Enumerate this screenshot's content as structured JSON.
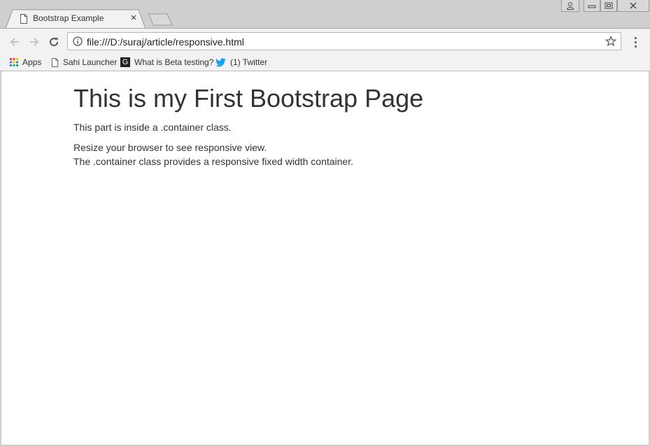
{
  "browser": {
    "tab": {
      "title": "Bootstrap Example",
      "close_glyph": "×",
      "icon": "document-icon"
    },
    "address_bar": {
      "url": "file:///D:/suraj/article/responsive.html",
      "info_icon": "info-icon",
      "bookmark_icon": "star-icon"
    },
    "bookmarks": [
      {
        "label": "Apps",
        "icon": "apps-grid-icon"
      },
      {
        "label": "Sahi Launcher",
        "icon": "document-icon"
      },
      {
        "label": "What is Beta testing?",
        "icon": "g-favicon-icon",
        "favicon_letter": "G"
      },
      {
        "label": "(1) Twitter",
        "icon": "twitter-bird-icon"
      }
    ]
  },
  "page": {
    "heading": "This is my First Bootstrap Page",
    "paragraph1": "This part is inside a .container class.",
    "paragraph2_line1": "Resize your browser to see responsive view.",
    "paragraph2_line2": "The .container class provides a responsive fixed width container."
  },
  "colors": {
    "frame": "#cfcfcf",
    "toolbar": "#f2f2f2",
    "page_bg": "#ffffff",
    "text": "#333333",
    "twitter_blue": "#1da1f2"
  }
}
